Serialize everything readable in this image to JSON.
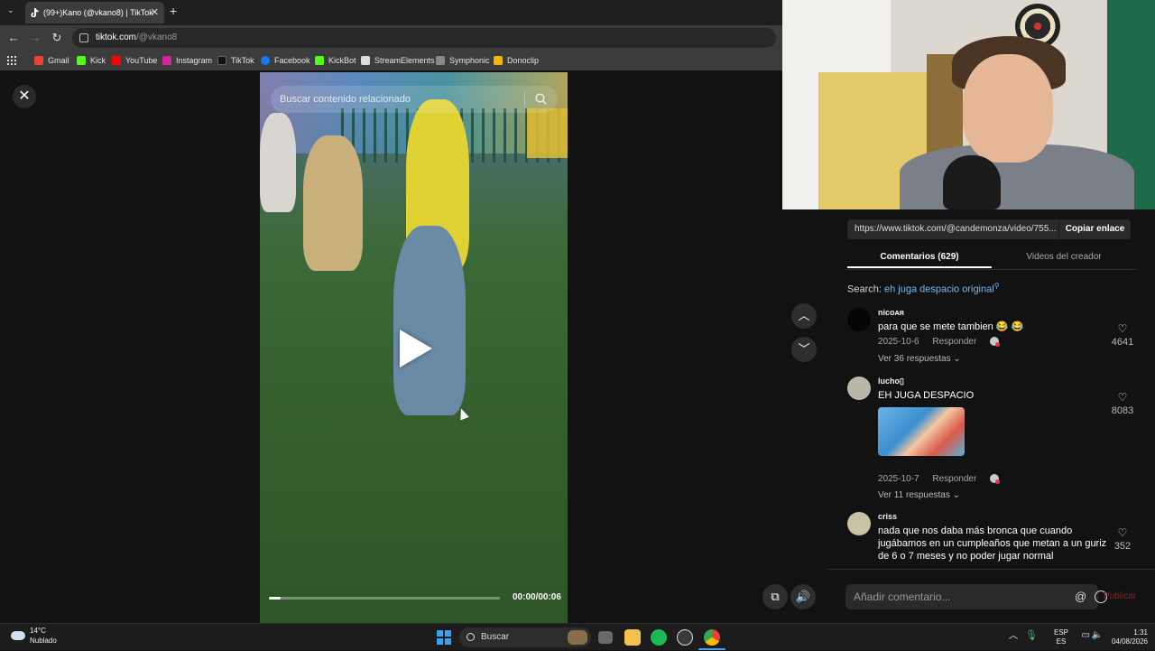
{
  "browser": {
    "tab_title": "(99+)Kano (@vkano8) | TikTok",
    "url_host": "tiktok.com",
    "url_path": "/@vkano8",
    "bookmarks": [
      "Gmail",
      "Kick",
      "YouTube",
      "Instagram",
      "TikTok",
      "Facebook",
      "KickBot",
      "StreamElements",
      "Symphonic",
      "Donoclip"
    ]
  },
  "video": {
    "search_placeholder": "Buscar contenido relacionado",
    "time": "00:00/00:06",
    "progress_fraction": 0.05
  },
  "panel": {
    "link_url": "https://www.tiktok.com/@candemonza/video/755...",
    "copy_link_label": "Copiar enlace",
    "tabs": [
      "Comentarios (629)",
      "Videos del creador"
    ],
    "search_label": "Search:",
    "search_query": "eh juga despacio original",
    "comments": [
      {
        "user": "nicoᴀʀ",
        "text": "para que se mete tambien 😂 😂",
        "date": "2025-10-6",
        "reply": "Responder",
        "more": "Ver 36 respuestas ⌄",
        "likes": "4641"
      },
      {
        "user": "lucho▯",
        "text": "EH JUGA DESPACIO",
        "date": "2025-10-7",
        "reply": "Responder",
        "more": "Ver 11 respuestas ⌄",
        "likes": "8083"
      },
      {
        "user": "criss",
        "text": "nada que nos daba más bronca que cuando jugábamos en un cumpleaños que metan a un guriz de 6 o 7 meses y no poder jugar normal",
        "likes": "352"
      }
    ],
    "comment_placeholder": "Añadir comentario...",
    "publish_label": "Publicar"
  },
  "taskbar": {
    "temp": "14°C",
    "weather": "Nublado",
    "search_label": "Buscar",
    "lang_top": "ESP",
    "lang_bottom": "ES",
    "time": "1:31",
    "date": "04/08/2026"
  },
  "colors": {
    "accent": "#fe2c55",
    "link_blue": "#7db7f7"
  }
}
